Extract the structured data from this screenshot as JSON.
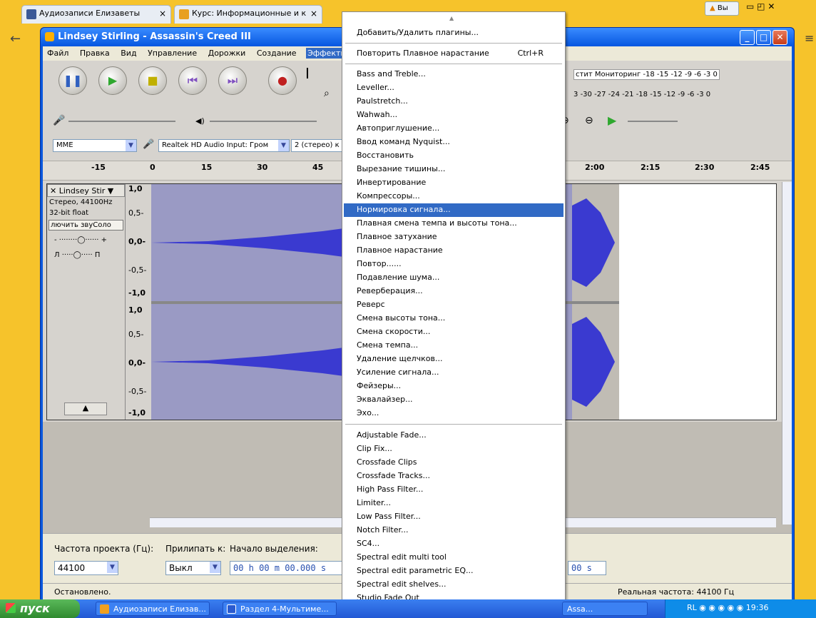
{
  "browser": {
    "tabs": [
      {
        "title": "Аудиозаписи Елизаветы",
        "close": "×"
      },
      {
        "title": "Курс: Информационные и к",
        "close": "×"
      }
    ],
    "top_right_label": "Вы"
  },
  "window": {
    "title": "Lindsey Stirling - Assassin's Creed III",
    "menu": [
      "Файл",
      "Правка",
      "Вид",
      "Управление",
      "Дорожки",
      "Создание",
      "Эффекты"
    ],
    "active_menu": "Эффекты"
  },
  "toolbar": {
    "monitor_label": "стит Мониторинг",
    "meter_ticks_1": [
      "-18",
      "-15",
      "-12",
      "-9",
      "-6",
      "-3",
      "0"
    ],
    "meter_ticks_2": [
      "3",
      "-30",
      "-27",
      "-24",
      "-21",
      "-18",
      "-15",
      "-12",
      "-9",
      "-6",
      "-3",
      "0"
    ],
    "host": "MME",
    "input_device": "Realtek HD Audio Input: Гром",
    "channels": "2 (стерео) к"
  },
  "timeline": {
    "ticks": [
      "-15",
      "0",
      "15",
      "30",
      "45",
      "2:00",
      "2:15",
      "2:30",
      "2:45"
    ]
  },
  "track": {
    "name": "Lindsey Stir",
    "format": "Стерео, 44100Hz",
    "bits": "32-bit float",
    "mute_solo": "лючить звуСоло",
    "gain_minus": "-",
    "gain_plus": "+",
    "pan_left": "Л",
    "pan_right": "П",
    "scale_top": [
      "1,0",
      "0,5-",
      "0,0-",
      "-0,5-",
      "-1,0"
    ],
    "scale_bottom": [
      "1,0",
      "0,5-",
      "0,0-",
      "-0,5-",
      "-1,0"
    ]
  },
  "selection_bar": {
    "rate_label": "Частота проекта (Гц):",
    "snap_label": "Прилипать к:",
    "start_label": "Начало выделения:",
    "rate_value": "44100",
    "snap_value": "Выкл",
    "start_value": "00 h 00 m 00.000 s",
    "end_value": "00 s"
  },
  "status": {
    "left": "Остановлено.",
    "right": "Реальная частота: 44100 Гц"
  },
  "effects_menu": {
    "items_group1": [
      "Добавить/Удалить плагины..."
    ],
    "repeat_item": "Повторить Плавное нарастание",
    "repeat_shortcut": "Ctrl+R",
    "items_group2": [
      "Bass and Treble...",
      "Leveller...",
      "Paulstretch...",
      "Wahwah...",
      "Автоприглушение...",
      "Ввод команд Nyquist...",
      "Восстановить",
      "Вырезание тишины...",
      "Инвертирование",
      "Компрессоры...",
      "Нормировка сигнала...",
      "Плавная смена темпа и высоты тона...",
      "Плавное затухание",
      "Плавное нарастание",
      "Повтор......",
      "Подавление шума...",
      "Реверберация...",
      "Реверс",
      "Смена высоты тона...",
      "Смена скорости...",
      "Смена темпа...",
      "Удаление щелчков...",
      "Усиление сигнала...",
      "Фейзеры...",
      "Эквалайзер...",
      "Эхо..."
    ],
    "highlighted": "Нормировка сигнала...",
    "items_group3": [
      "Adjustable Fade...",
      "Clip Fix...",
      "Crossfade Clips",
      "Crossfade Tracks...",
      "High Pass Filter...",
      "Limiter...",
      "Low Pass Filter...",
      "Notch Filter...",
      "SC4...",
      "Spectral edit multi tool",
      "Spectral edit parametric EQ...",
      "Spectral edit shelves...",
      "Studio Fade Out"
    ]
  },
  "taskbar": {
    "start": "пуск",
    "items": [
      "Аудиозаписи Елизав...",
      "Раздел 4-Мультиме...",
      "Assa..."
    ],
    "tray_lang": "RL",
    "clock": "19:36"
  },
  "colors": {
    "menu_highlight": "#316ac5",
    "xp_blue": "#0656e0",
    "waveform": "#3a3ad0",
    "wave_bg": "#9a9ac4"
  }
}
